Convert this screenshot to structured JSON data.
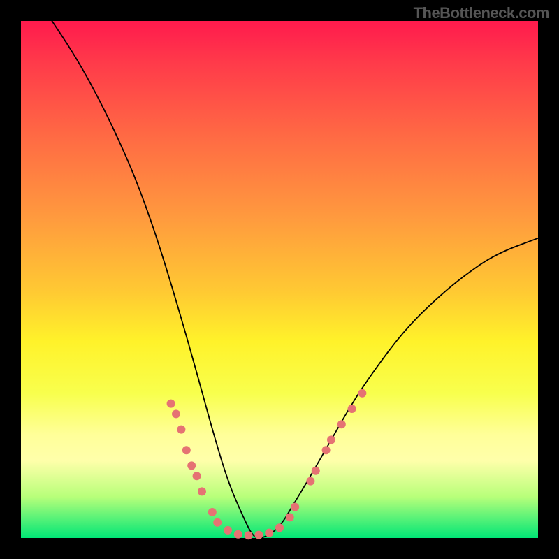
{
  "watermark": "TheBottleneck.com",
  "colors": {
    "background": "#000000",
    "gradient_top": "#ff1a4d",
    "gradient_bottom": "#00e676",
    "curve": "#000000",
    "points": "#e57373"
  },
  "chart_data": {
    "type": "line",
    "title": "",
    "xlabel": "",
    "ylabel": "",
    "xlim": [
      0,
      100
    ],
    "ylim": [
      0,
      100
    ],
    "grid": false,
    "legend": "none",
    "description": "V-shaped bottleneck curve. Minimum near x≈45 at y≈0. Left branch starts near top-left (x≈7, y≈100) descending to the trough; right branch rises from the trough toward upper-right, ending near (x=100, y≈58). Scattered points cluster along both branches in the lower region of the chart.",
    "curve_samples_x_y": [
      [
        6,
        100
      ],
      [
        10,
        94
      ],
      [
        14,
        87
      ],
      [
        18,
        79
      ],
      [
        22,
        70
      ],
      [
        26,
        59
      ],
      [
        30,
        46
      ],
      [
        34,
        32
      ],
      [
        37,
        21
      ],
      [
        40,
        11
      ],
      [
        43,
        4
      ],
      [
        45,
        0
      ],
      [
        47,
        0
      ],
      [
        50,
        2
      ],
      [
        53,
        7
      ],
      [
        56,
        12
      ],
      [
        60,
        19
      ],
      [
        64,
        26
      ],
      [
        68,
        32
      ],
      [
        74,
        40
      ],
      [
        80,
        46
      ],
      [
        86,
        51
      ],
      [
        92,
        55
      ],
      [
        100,
        58
      ]
    ],
    "series": [
      {
        "name": "points",
        "xy": [
          [
            29,
            26
          ],
          [
            30,
            24
          ],
          [
            31,
            21
          ],
          [
            32,
            17
          ],
          [
            33,
            14
          ],
          [
            34,
            12
          ],
          [
            35,
            9
          ],
          [
            37,
            5
          ],
          [
            38,
            3
          ],
          [
            40,
            1.5
          ],
          [
            42,
            0.7
          ],
          [
            44,
            0.5
          ],
          [
            46,
            0.6
          ],
          [
            48,
            1
          ],
          [
            50,
            2
          ],
          [
            52,
            4
          ],
          [
            53,
            6
          ],
          [
            56,
            11
          ],
          [
            57,
            13
          ],
          [
            59,
            17
          ],
          [
            60,
            19
          ],
          [
            62,
            22
          ],
          [
            64,
            25
          ],
          [
            66,
            28
          ]
        ]
      }
    ]
  }
}
